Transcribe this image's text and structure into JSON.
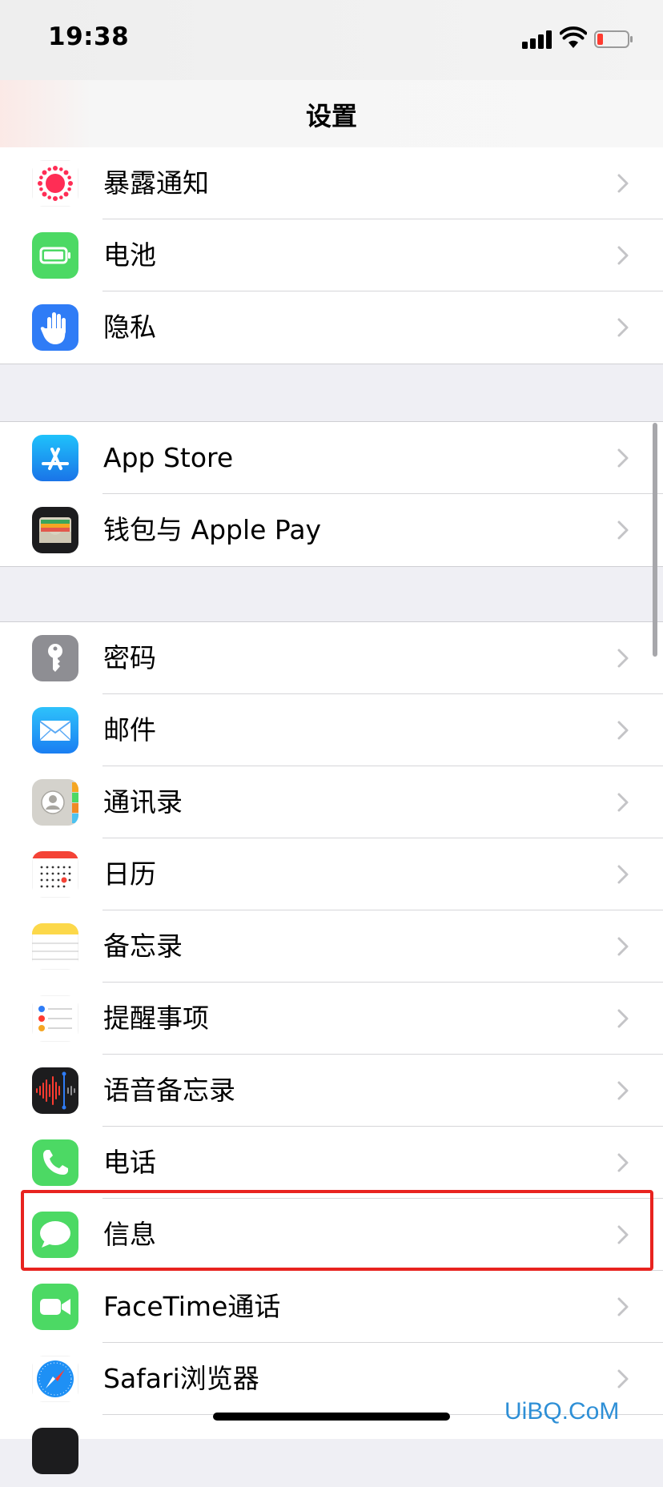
{
  "status_bar": {
    "time": "19:38"
  },
  "nav": {
    "title": "设置"
  },
  "groups": [
    {
      "items": [
        {
          "label": "暴露通知",
          "icon": "exposure-notification-icon"
        },
        {
          "label": "电池",
          "icon": "battery-icon"
        },
        {
          "label": "隐私",
          "icon": "privacy-hand-icon"
        }
      ]
    },
    {
      "items": [
        {
          "label": "App Store",
          "icon": "app-store-icon"
        },
        {
          "label": "钱包与 Apple Pay",
          "icon": "wallet-icon"
        }
      ]
    },
    {
      "items": [
        {
          "label": "密码",
          "icon": "key-icon"
        },
        {
          "label": "邮件",
          "icon": "mail-icon"
        },
        {
          "label": "通讯录",
          "icon": "contacts-icon"
        },
        {
          "label": "日历",
          "icon": "calendar-icon"
        },
        {
          "label": "备忘录",
          "icon": "notes-icon"
        },
        {
          "label": "提醒事项",
          "icon": "reminders-icon"
        },
        {
          "label": "语音备忘录",
          "icon": "voice-memos-icon"
        },
        {
          "label": "电话",
          "icon": "phone-icon"
        },
        {
          "label": "信息",
          "icon": "messages-icon",
          "highlighted": true
        },
        {
          "label": "FaceTime通话",
          "icon": "facetime-icon"
        },
        {
          "label": "Safari浏览器",
          "icon": "safari-icon"
        }
      ]
    }
  ],
  "colors": {
    "highlight_box": "#e8231f",
    "watermark": "#2e8fd6"
  },
  "watermark": "UiBQ.CoM"
}
